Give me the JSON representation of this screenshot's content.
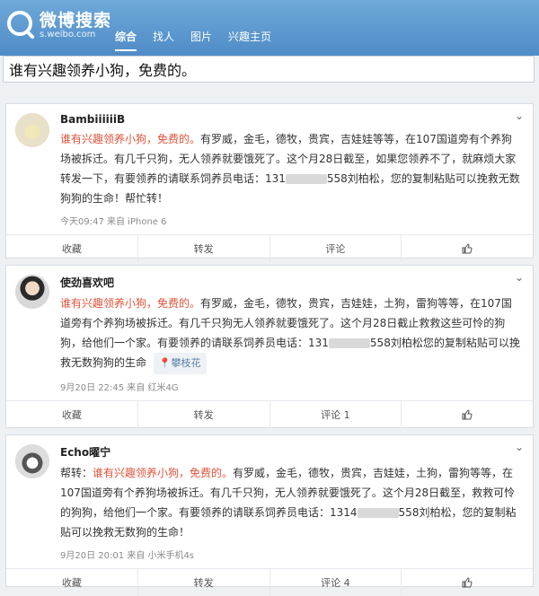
{
  "app": {
    "title": "微博搜索",
    "subtitle": "s.weibo.com"
  },
  "nav": {
    "items": [
      {
        "label": "综合"
      },
      {
        "label": "找人"
      },
      {
        "label": "图片"
      },
      {
        "label": "兴趣主页"
      }
    ]
  },
  "search": {
    "query": "谁有兴趣领养小狗，免费的。"
  },
  "posts": [
    {
      "user": "BambiiiiiiB",
      "hl": "谁有兴趣领养小狗，免费的。",
      "t1": "有罗威，金毛，德牧，贵宾，吉娃娃等等，在107国道旁有个养狗场被拆迁。有几千只狗，无人领养就要饿死了。这个月28日截至，如果您领养不了，就麻烦大家转发一下，有要领养的请联系饲养员电话：131",
      "t2": "558刘柏松，您的复制粘贴可以挽救无数狗狗的生命！帮忙转！",
      "meta": "今天09:47 来自 iPhone 6",
      "actions": [
        "收藏",
        "转发",
        "评论",
        ""
      ]
    },
    {
      "user": "使劲喜欢吧",
      "hl": "谁有兴趣领养小狗，免费的。",
      "t1": "有罗威，金毛，德牧，贵宾，吉娃娃，土狗，雷狗等等，在107国道旁有个养狗场被拆迁。有几千只狗无人领养就要饿死了。这个月28日截止救救这些可怜的狗狗，给他们一个家。有要领养的请联系饲养员电话：131",
      "t2": "558刘柏松您的复制粘贴可以挽救无数狗狗的生命",
      "loc": "攀枝花",
      "meta": "9月20日 22:45 来自 红米4G",
      "actions": [
        "收藏",
        "转发",
        "评论 1",
        ""
      ]
    },
    {
      "user": "Echo曜宁",
      "pre": "帮转：",
      "hl": "谁有兴趣领养小狗，免费的。",
      "t1": "有罗威，金毛，德牧，贵宾，吉娃娃，土狗，雷狗等等，在107国道旁有个养狗场被拆迁。有几千只狗，无人领养就要饿死了。这个月28日截至，救救可怜的狗狗，给他们一个家。有要领养的请联系饲养员电话：1314",
      "t2": "558刘柏松，您的复制粘贴可以挽救无数狗的生命！",
      "meta": "9月20日 20:01 来自 小米手机4s",
      "actions": [
        "收藏",
        "转发",
        "评论 4",
        ""
      ]
    }
  ]
}
